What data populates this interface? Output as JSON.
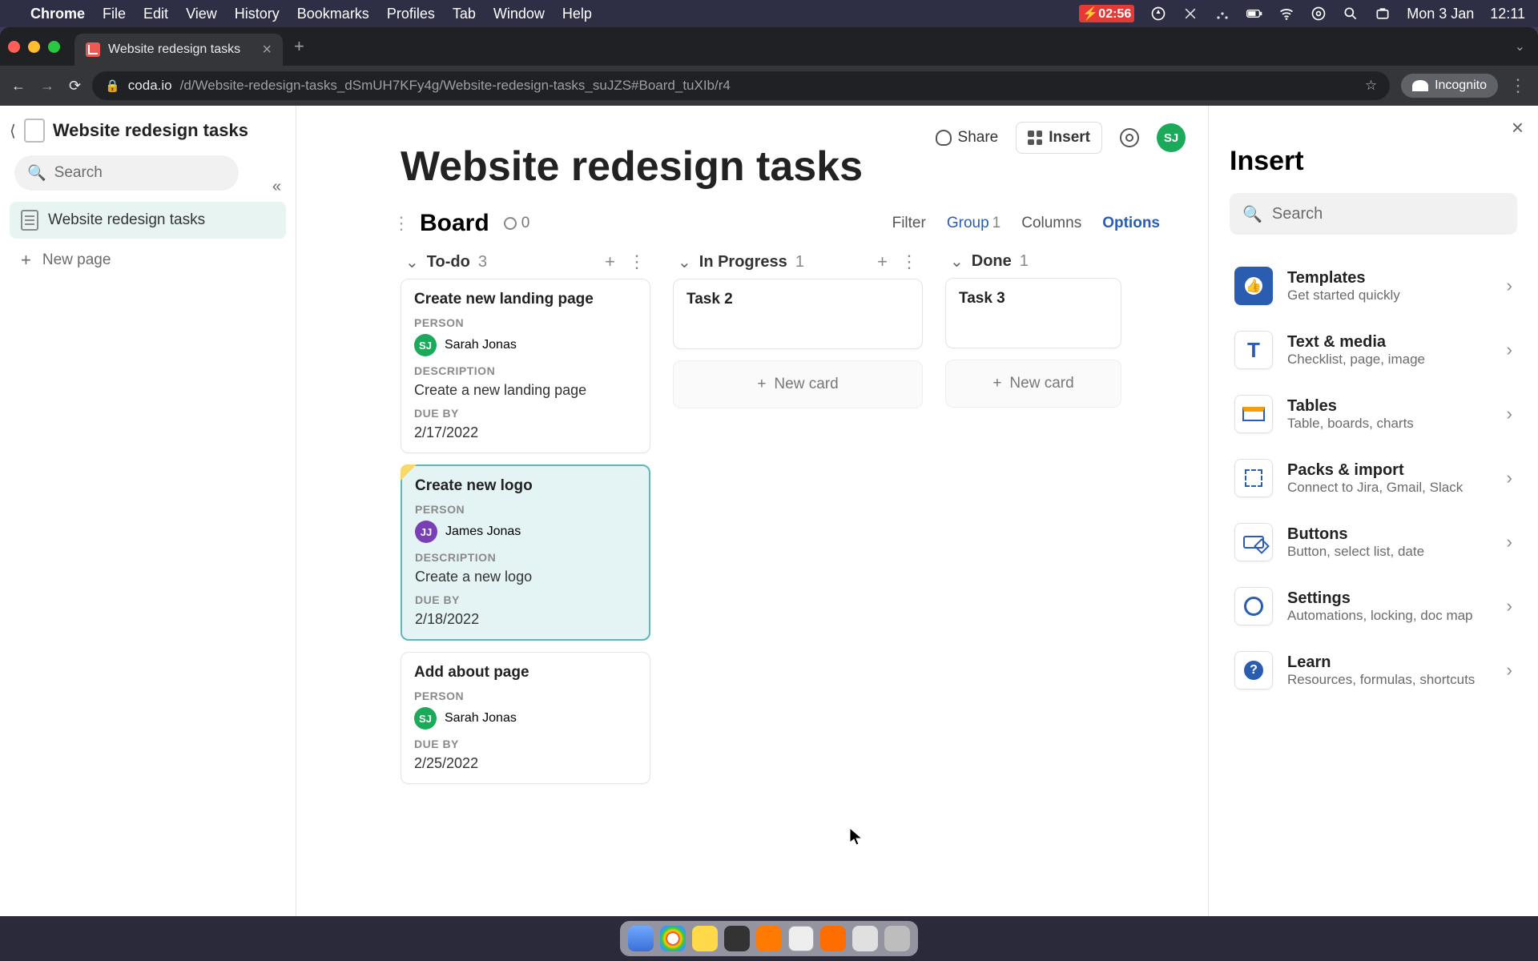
{
  "mac_menu": {
    "app": "Chrome",
    "items": [
      "File",
      "Edit",
      "View",
      "History",
      "Bookmarks",
      "Profiles",
      "Tab",
      "Window",
      "Help"
    ],
    "battery": "02:56",
    "date": "Mon 3 Jan",
    "time": "12:11"
  },
  "browser": {
    "tab_title": "Website redesign tasks",
    "url_host": "coda.io",
    "url_path": "/d/Website-redesign-tasks_dSmUH7KFy4g/Website-redesign-tasks_suJZS#Board_tuXIb/r4",
    "incognito": "Incognito"
  },
  "sidebar": {
    "doc_title": "Website redesign tasks",
    "search_placeholder": "Search",
    "pages": [
      {
        "label": "Website redesign tasks",
        "active": true
      }
    ],
    "new_page": "New page"
  },
  "header": {
    "share": "Share",
    "insert": "Insert",
    "avatar": "SJ"
  },
  "doc": {
    "title": "Website redesign tasks",
    "board_label": "Board",
    "link_count": "0",
    "toolbar": {
      "filter": "Filter",
      "group_label": "Group",
      "group_count": "1",
      "columns": "Columns",
      "options": "Options"
    }
  },
  "board": {
    "columns": [
      {
        "title": "To-do",
        "count": "3",
        "cards": [
          {
            "title": "Create new landing page",
            "person_label": "PERSON",
            "person_initials": "SJ",
            "person_color": "g",
            "person_name": "Sarah Jonas",
            "desc_label": "DESCRIPTION",
            "description": "Create a new landing page",
            "due_label": "DUE BY",
            "due": "2/17/2022",
            "selected": false
          },
          {
            "title": "Create new logo",
            "person_label": "PERSON",
            "person_initials": "JJ",
            "person_color": "p",
            "person_name": "James Jonas",
            "desc_label": "DESCRIPTION",
            "description": "Create a new logo",
            "due_label": "DUE BY",
            "due": "2/18/2022",
            "selected": true
          },
          {
            "title": "Add about page",
            "person_label": "PERSON",
            "person_initials": "SJ",
            "person_color": "g",
            "person_name": "Sarah Jonas",
            "desc_label": "",
            "description": "",
            "due_label": "DUE BY",
            "due": "2/25/2022",
            "selected": false
          }
        ],
        "new_card": "New card"
      },
      {
        "title": "In Progress",
        "count": "1",
        "cards": [
          {
            "title": "Task 2",
            "simple": true
          }
        ],
        "new_card": "New card"
      },
      {
        "title": "Done",
        "count": "1",
        "cards": [
          {
            "title": "Task 3",
            "simple": true
          }
        ],
        "new_card": "New card"
      }
    ]
  },
  "insert_panel": {
    "title": "Insert",
    "search_placeholder": "Search",
    "items": [
      {
        "title": "Templates",
        "sub": "Get started quickly",
        "icon": "thumb"
      },
      {
        "title": "Text & media",
        "sub": "Checklist, page, image",
        "icon": "text"
      },
      {
        "title": "Tables",
        "sub": "Table, boards, charts",
        "icon": "table"
      },
      {
        "title": "Packs & import",
        "sub": "Connect to Jira, Gmail, Slack",
        "icon": "pack"
      },
      {
        "title": "Buttons",
        "sub": "Button, select list, date",
        "icon": "button"
      },
      {
        "title": "Settings",
        "sub": "Automations, locking, doc map",
        "icon": "gear"
      },
      {
        "title": "Learn",
        "sub": "Resources, formulas, shortcuts",
        "icon": "learn"
      }
    ]
  }
}
